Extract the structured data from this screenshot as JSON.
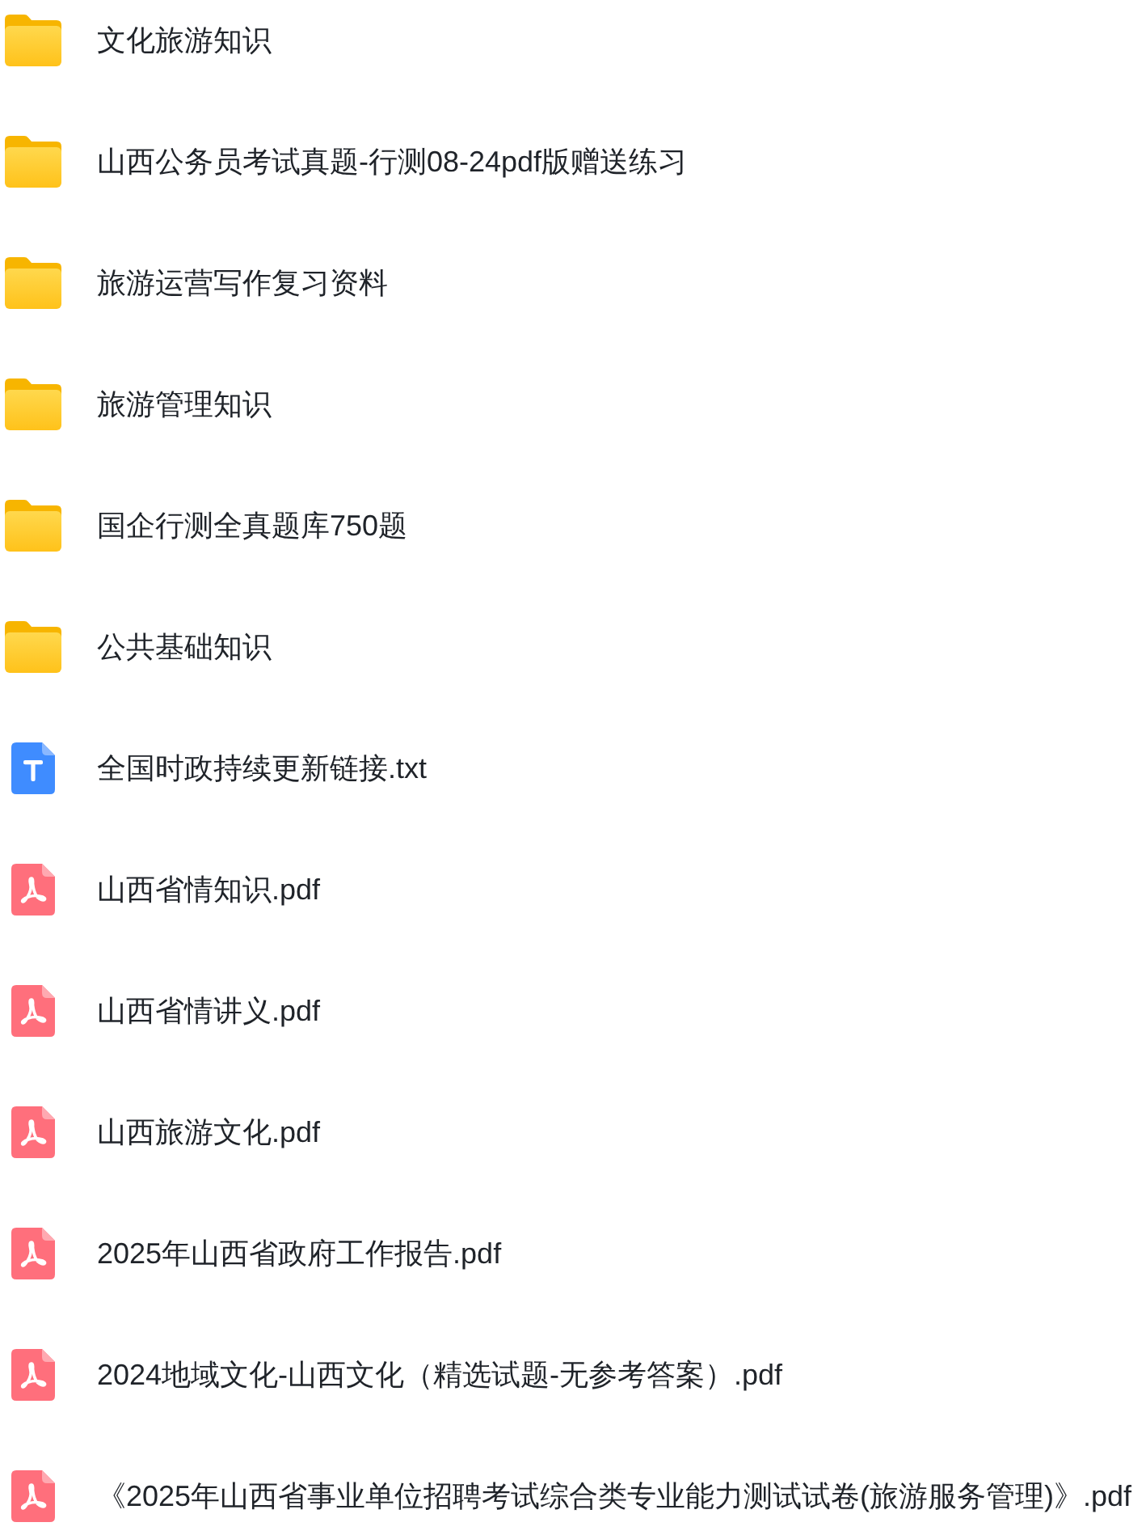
{
  "files": [
    {
      "kind": "folder",
      "name": "文化旅游知识"
    },
    {
      "kind": "folder",
      "name": "山西公务员考试真题-行测08-24pdf版赠送练习"
    },
    {
      "kind": "folder",
      "name": "旅游运营写作复习资料"
    },
    {
      "kind": "folder",
      "name": "旅游管理知识"
    },
    {
      "kind": "folder",
      "name": "国企行测全真题库750题"
    },
    {
      "kind": "folder",
      "name": "公共基础知识"
    },
    {
      "kind": "txt",
      "name": "全国时政持续更新链接.txt"
    },
    {
      "kind": "pdf",
      "name": "山西省情知识.pdf"
    },
    {
      "kind": "pdf",
      "name": "山西省情讲义.pdf"
    },
    {
      "kind": "pdf",
      "name": "山西旅游文化.pdf"
    },
    {
      "kind": "pdf",
      "name": "2025年山西省政府工作报告.pdf"
    },
    {
      "kind": "pdf",
      "name": "2024地域文化-山西文化（精选试题-无参考答案）.pdf"
    },
    {
      "kind": "pdf",
      "name": "《2025年山西省事业单位招聘考试综合类专业能力测试试卷(旅游服务管理)》.pdf"
    }
  ]
}
